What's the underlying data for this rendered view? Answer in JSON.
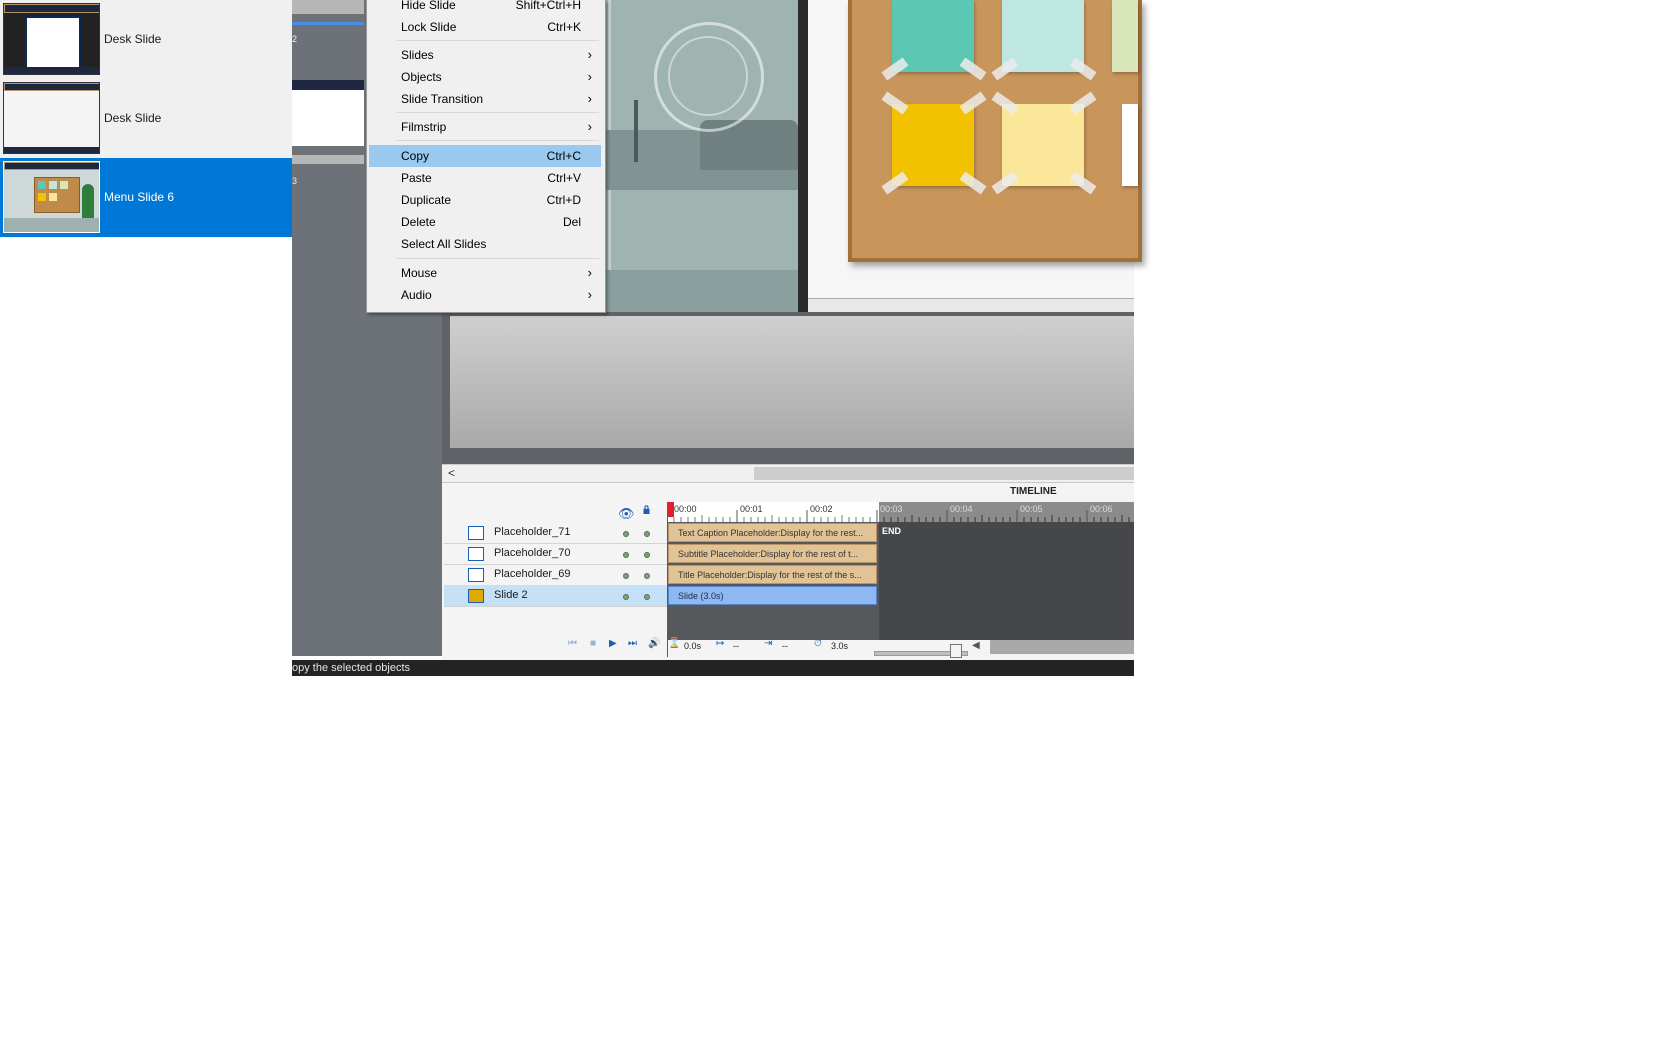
{
  "filmstrip": {
    "items": [
      {
        "label": "Desk Slide",
        "selected": false
      },
      {
        "label": "Desk Slide",
        "selected": false
      },
      {
        "label": "Menu Slide 6",
        "selected": true
      }
    ]
  },
  "midstrip": {
    "numbers": [
      "2",
      "3"
    ]
  },
  "context_menu": {
    "items": [
      {
        "label": "Hide Slide",
        "shortcut": "Shift+Ctrl+H"
      },
      {
        "label": "Lock Slide",
        "shortcut": "Ctrl+K"
      },
      {
        "label": "Slides",
        "submenu": true
      },
      {
        "label": "Objects",
        "submenu": true
      },
      {
        "label": "Slide Transition",
        "submenu": true
      },
      {
        "label": "Filmstrip",
        "submenu": true
      },
      {
        "label": "Copy",
        "shortcut": "Ctrl+C",
        "highlighted": true
      },
      {
        "label": "Paste",
        "shortcut": "Ctrl+V"
      },
      {
        "label": "Duplicate",
        "shortcut": "Ctrl+D"
      },
      {
        "label": "Delete",
        "shortcut": "Del"
      },
      {
        "label": "Select All Slides"
      },
      {
        "label": "Mouse",
        "submenu": true
      },
      {
        "label": "Audio",
        "submenu": true
      }
    ]
  },
  "scroll": {
    "left_arrow": "<"
  },
  "timeline": {
    "title": "TIMELINE",
    "ruler_ticks": [
      "00:00",
      "00:01",
      "00:02",
      "00:03",
      "00:04",
      "00:05",
      "00:06"
    ],
    "end_label": "END",
    "rows": [
      {
        "name": "Placeholder_71",
        "bar": "Text Caption Placeholder:Display for the rest...",
        "selected": false
      },
      {
        "name": "Placeholder_70",
        "bar": "Subtitle Placeholder:Display for the rest of t...",
        "selected": false
      },
      {
        "name": "Placeholder_69",
        "bar": "Title Placeholder:Display for the rest of the s...",
        "selected": false
      },
      {
        "name": "Slide 2",
        "bar": "Slide (3.0s)",
        "selected": true
      }
    ],
    "controls": {
      "current_time": "0.0s",
      "start_value": "--",
      "end_value": "--",
      "duration": "3.0s"
    }
  },
  "status_bar": {
    "text": "opy the selected objects"
  },
  "colors": {
    "selection_blue": "#0078d7",
    "menu_highlight": "#99c9ef",
    "timeline_bar": "#e2c396",
    "slide_bar": "#8eb8f1",
    "playhead": "#e0202a"
  }
}
